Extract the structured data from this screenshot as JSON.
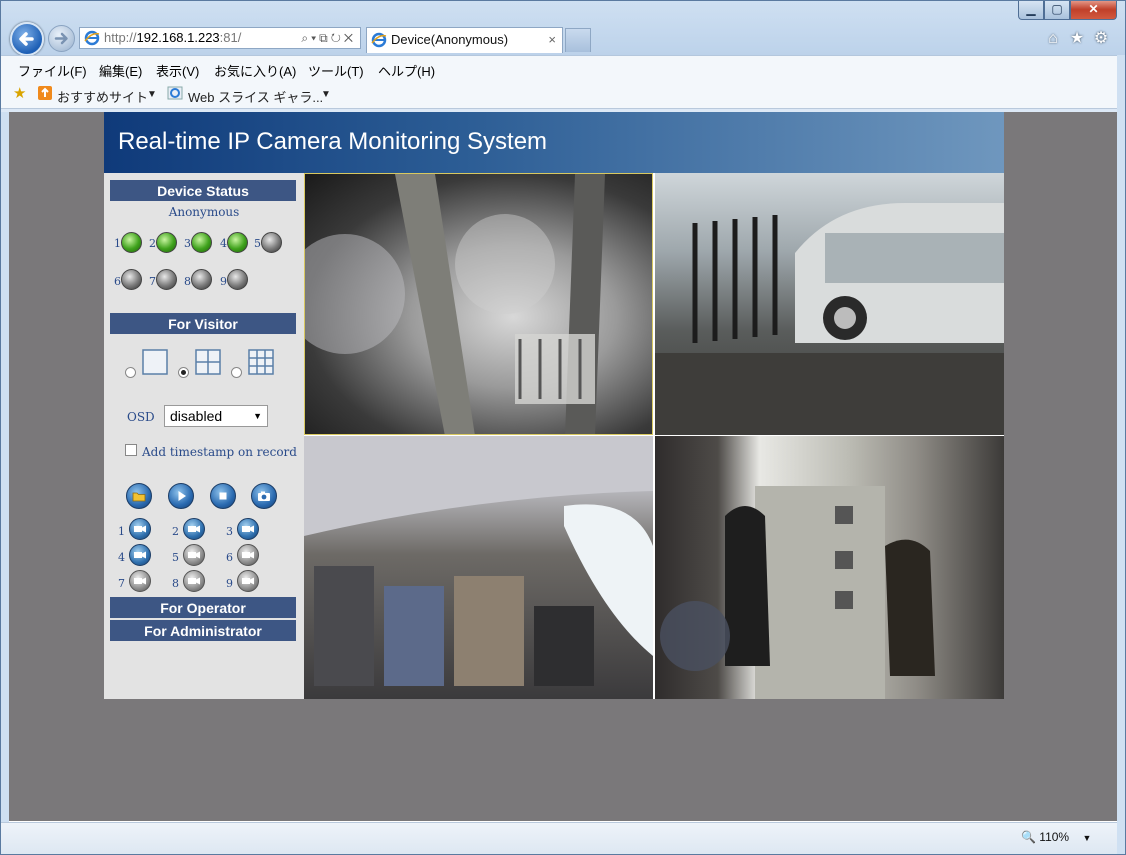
{
  "browser": {
    "address_scheme": "http://",
    "address_host": "192.168.1.223",
    "address_port": ":81/",
    "address_tools": "⌕▾⧉↻✕",
    "tab_title": "Device(Anonymous)",
    "tab_close": "×",
    "window_buttons": {
      "minimize": "▁",
      "maximize": "▢",
      "close": "✕"
    },
    "right_icons": [
      "home-icon",
      "star-icon",
      "gear-icon"
    ],
    "menu": [
      "ファイル(F)",
      "編集(E)",
      "表示(V)",
      "お気に入り(A)",
      "ツール(T)",
      "ヘルプ(H)"
    ],
    "favorites": {
      "suggested": "おすすめサイト",
      "web_slice": "Web スライス ギャラ..."
    },
    "zoom": "110%"
  },
  "app": {
    "title": "Real-time IP Camera Monitoring System",
    "device_status": {
      "heading": "Device Status",
      "device_name": "Anonymous",
      "leds": [
        {
          "num": "1",
          "on": true
        },
        {
          "num": "2",
          "on": true
        },
        {
          "num": "3",
          "on": true
        },
        {
          "num": "4",
          "on": true
        },
        {
          "num": "5",
          "on": false
        },
        {
          "num": "6",
          "on": false
        },
        {
          "num": "7",
          "on": false
        },
        {
          "num": "8",
          "on": false
        },
        {
          "num": "9",
          "on": false
        }
      ]
    },
    "visitor": {
      "heading": "For Visitor",
      "layouts": [
        "1-view",
        "4-view",
        "9-view"
      ],
      "selected_layout": "4-view",
      "osd_label": "OSD",
      "osd_value": "disabled",
      "timestamp_label": "Add timestamp on record",
      "timestamp_checked": false,
      "controls": [
        "folder-icon",
        "play-icon",
        "stop-icon",
        "snapshot-icon"
      ],
      "cameras": [
        {
          "num": "1",
          "active": true
        },
        {
          "num": "2",
          "active": true
        },
        {
          "num": "3",
          "active": true
        },
        {
          "num": "4",
          "active": true
        },
        {
          "num": "5",
          "active": false
        },
        {
          "num": "6",
          "active": false
        },
        {
          "num": "7",
          "active": false
        },
        {
          "num": "8",
          "active": false
        },
        {
          "num": "9",
          "active": false
        }
      ]
    },
    "operator": {
      "heading": "For Operator"
    },
    "administrator": {
      "heading": "For Administrator"
    }
  }
}
